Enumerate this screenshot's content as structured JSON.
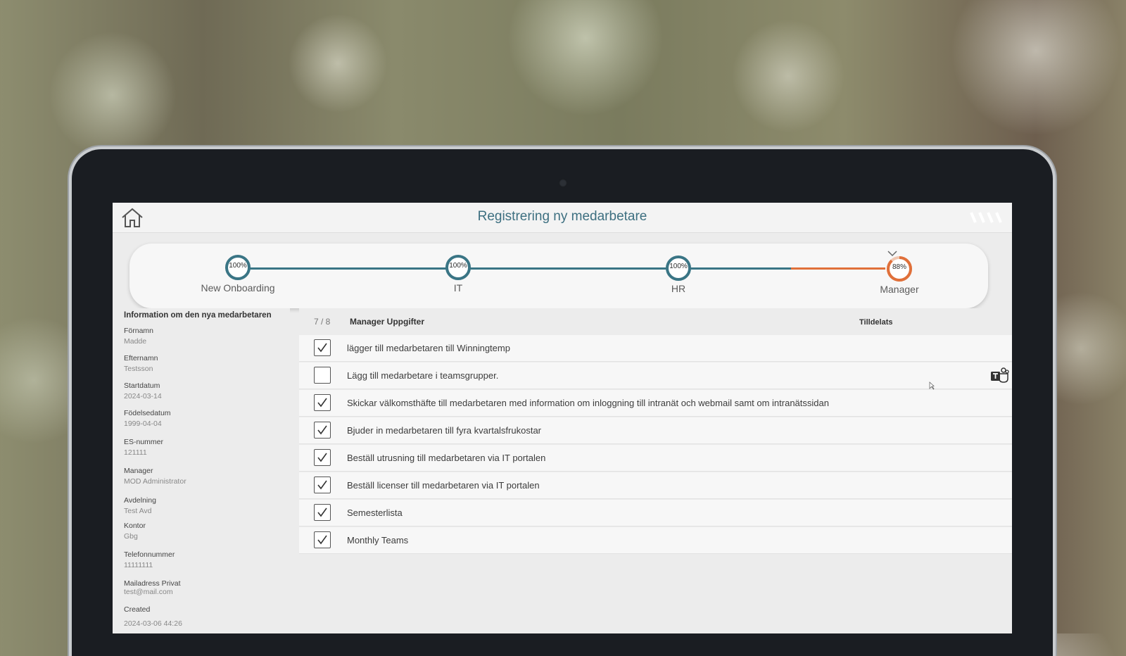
{
  "header": {
    "title": "Registrering ny medarbetare"
  },
  "stepper": {
    "steps": [
      {
        "label": "New Onboarding",
        "percent": "100%",
        "value": 100,
        "color": "#3a7585"
      },
      {
        "label": "IT",
        "percent": "100%",
        "value": 100,
        "color": "#3a7585"
      },
      {
        "label": "HR",
        "percent": "100%",
        "value": 100,
        "color": "#3a7585"
      },
      {
        "label": "Manager",
        "percent": "88%",
        "value": 88,
        "color": "#e0703a"
      }
    ],
    "track_color": "#3a7585",
    "active_color": "#e0703a"
  },
  "info": {
    "title": "Information om den nya medarbetaren",
    "fields": [
      {
        "label": "Förnamn",
        "value": "Madde"
      },
      {
        "label": "Efternamn",
        "value": "Testsson"
      },
      {
        "label": "Startdatum",
        "value": "2024-03-14"
      },
      {
        "label": "Födelsedatum",
        "value": "1999-04-04"
      },
      {
        "label": "ES-nummer",
        "value": "121111"
      },
      {
        "label": "Manager",
        "value": "MOD Administrator"
      },
      {
        "label": "Avdelning",
        "value": "Test Avd"
      },
      {
        "label": "Kontor",
        "value": "Gbg"
      },
      {
        "label": "Telefonnummer",
        "value": "11111111"
      },
      {
        "label": "Mailadress Privat",
        "value": "test@mail.com"
      },
      {
        "label": "Created",
        "value": "2024-03-06 44:26"
      }
    ]
  },
  "tasks": {
    "count": "7 / 8",
    "title": "Manager Uppgifter",
    "assigned_header": "Tilldelats",
    "items": [
      {
        "text": "lägger till medarbetaren till Winningtemp",
        "checked": true
      },
      {
        "text": "Lägg till medarbetare i teamsgrupper.",
        "checked": false,
        "icon": "teams-icon"
      },
      {
        "text": "Skickar välkomsthäfte till medarbetaren med information om inloggning till intranät och webmail samt om intranätssidan",
        "checked": true
      },
      {
        "text": "Bjuder in medarbetaren till fyra kvartalsfrukostar",
        "checked": true
      },
      {
        "text": "Beställ utrusning till medarbetaren via IT portalen",
        "checked": true
      },
      {
        "text": "Beställ licenser till medarbetaren via IT portalen",
        "checked": true
      },
      {
        "text": "Semesterlista",
        "checked": true
      },
      {
        "text": "Monthly Teams",
        "checked": true
      }
    ]
  },
  "icons": {
    "home": "home-icon",
    "logo": "brand-logo-icon",
    "chevron": "chevron-down-icon",
    "check": "check-icon",
    "teams": "teams-icon"
  }
}
